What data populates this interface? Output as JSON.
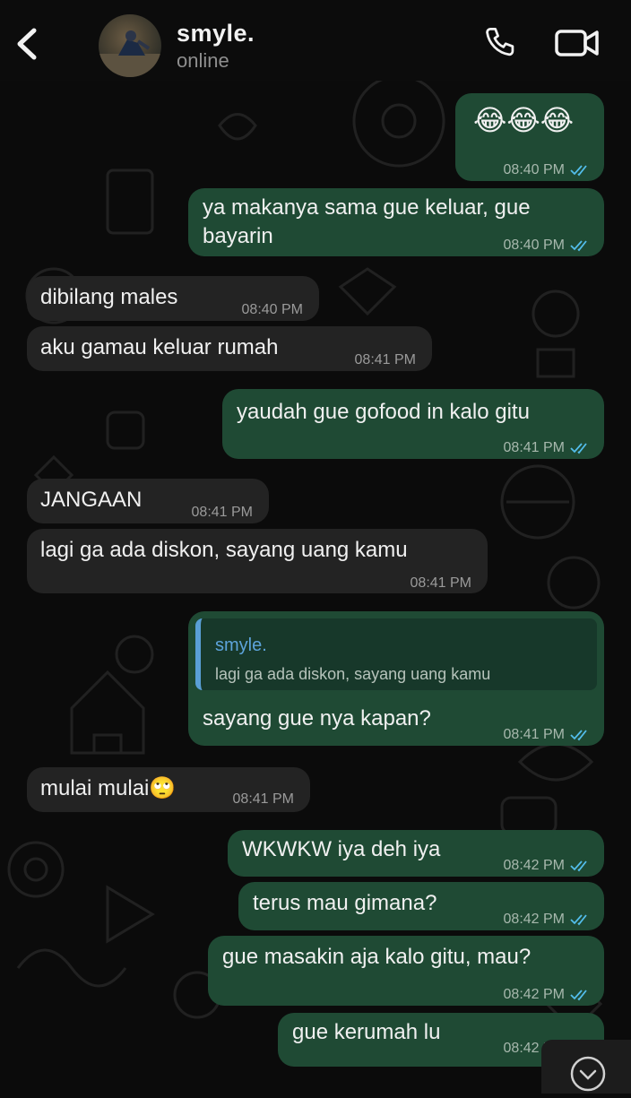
{
  "header": {
    "contact_name": "smyle.",
    "status": "online"
  },
  "icons": {
    "back": "chevron-left-icon",
    "call": "phone-icon",
    "video": "video-camera-icon",
    "read": "double-check-icon",
    "scroll": "chevron-down-icon"
  },
  "colors": {
    "outgoing_bubble": "#1f4a34",
    "incoming_bubble": "#232323",
    "quote_accent": "#5a9fd6",
    "read_tick": "#53bdeb"
  },
  "messages": [
    {
      "dir": "out",
      "text": "😂😂😂",
      "time": "08:40 PM",
      "read": true
    },
    {
      "dir": "out",
      "text_lines": [
        "ya makanya sama gue keluar, gue",
        "bayarin"
      ],
      "time": "08:40 PM",
      "read": true
    },
    {
      "dir": "in",
      "text": "dibilang males",
      "time": "08:40 PM"
    },
    {
      "dir": "in",
      "text": "aku gamau keluar rumah",
      "time": "08:41 PM"
    },
    {
      "dir": "out",
      "text": "yaudah gue gofood in kalo gitu",
      "time": "08:41 PM",
      "read": true
    },
    {
      "dir": "in",
      "text": "JANGAAN",
      "time": "08:41 PM"
    },
    {
      "dir": "in",
      "text": "lagi ga ada diskon, sayang uang kamu",
      "time": "08:41 PM"
    },
    {
      "dir": "out",
      "quote": {
        "name": "smyle.",
        "text": "lagi ga ada diskon, sayang uang kamu"
      },
      "text": "sayang gue nya kapan?",
      "time": "08:41 PM",
      "read": true
    },
    {
      "dir": "in",
      "text": "mulai mulai🙄",
      "time": "08:41 PM"
    },
    {
      "dir": "out",
      "text": "WKWKW iya deh iya",
      "time": "08:42 PM",
      "read": true
    },
    {
      "dir": "out",
      "text": "terus mau gimana?",
      "time": "08:42 PM",
      "read": true
    },
    {
      "dir": "out",
      "text": "gue masakin aja kalo gitu, mau?",
      "time": "08:42 PM",
      "read": true
    },
    {
      "dir": "out",
      "text": "gue kerumah lu",
      "time": "08:42 PM",
      "read": true
    }
  ]
}
